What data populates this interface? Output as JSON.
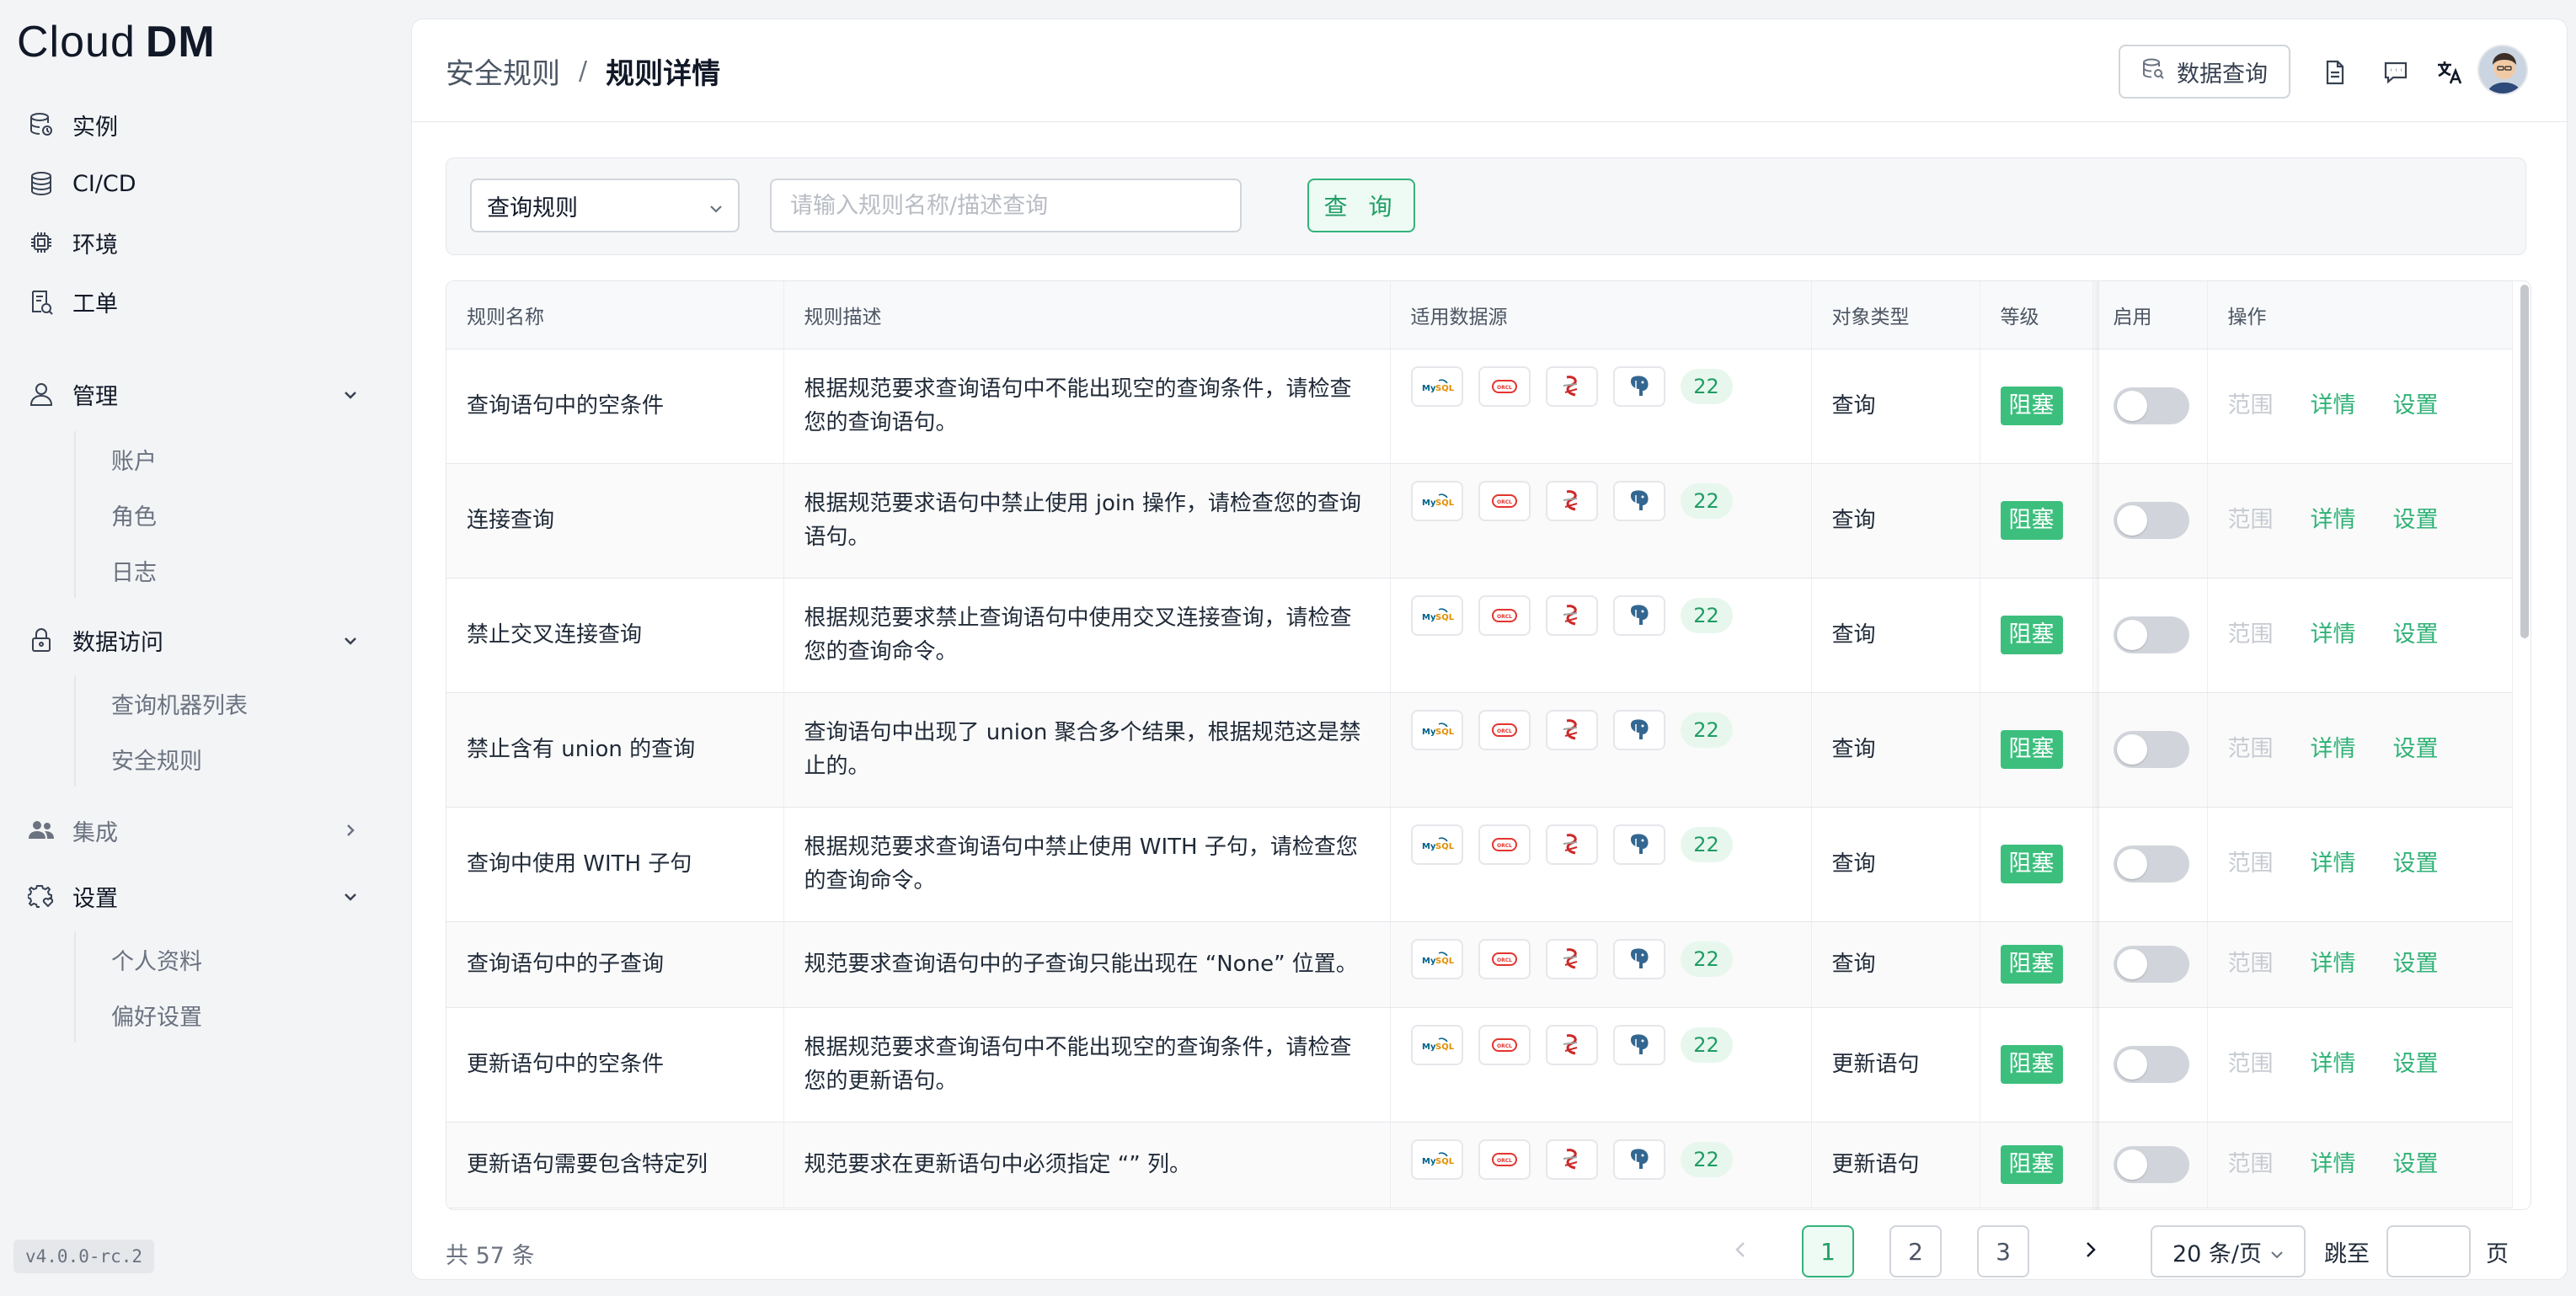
{
  "app": {
    "logo_text": "Cloud",
    "logo_text_bold": "DM",
    "version": "v4.0.0-rc.2"
  },
  "sidebar": {
    "items": [
      {
        "label": "实例",
        "icon": "database-stack-icon"
      },
      {
        "label": "CI/CD",
        "icon": "database-icon"
      },
      {
        "label": "环境",
        "icon": "chip-icon"
      },
      {
        "label": "工单",
        "icon": "ticket-icon"
      }
    ],
    "groups": [
      {
        "label": "管理",
        "icon": "user-icon",
        "expanded": true,
        "children": [
          "账户",
          "角色",
          "日志"
        ]
      },
      {
        "label": "数据访问",
        "icon": "lock-icon",
        "expanded": true,
        "children": [
          "查询机器列表",
          "安全规则"
        ]
      },
      {
        "label": "集成",
        "icon": "users-icon",
        "expanded": false,
        "children": []
      },
      {
        "label": "设置",
        "icon": "gear-heart-icon",
        "expanded": true,
        "children": [
          "个人资料",
          "偏好设置"
        ]
      }
    ]
  },
  "header": {
    "breadcrumb": [
      "安全规则",
      "规则详情"
    ],
    "separator": "/",
    "data_query_label": "数据查询",
    "icons": [
      "document-icon",
      "chat-icon",
      "translate-icon"
    ]
  },
  "filter": {
    "select_value": "查询规则",
    "search_placeholder": "请输入规则名称/描述查询",
    "query_button": "查 询"
  },
  "table": {
    "columns": [
      "规则名称",
      "规则描述",
      "适用数据源",
      "对象类型",
      "等级",
      "启用",
      "操作"
    ],
    "datasource_icons": [
      "mysql-icon",
      "oracle-icon",
      "sqlserver-icon",
      "postgresql-icon"
    ],
    "ops": {
      "range": "范围",
      "detail": "详情",
      "settings": "设置"
    },
    "rows": [
      {
        "name": "查询语句中的空条件",
        "desc": "根据规范要求查询语句中不能出现空的查询条件，请检查您的查询语句。",
        "count": "22",
        "type": "查询",
        "level": "阻塞",
        "enabled": false
      },
      {
        "name": "连接查询",
        "desc": "根据规范要求语句中禁止使用 join 操作，请检查您的查询语句。",
        "count": "22",
        "type": "查询",
        "level": "阻塞",
        "enabled": false
      },
      {
        "name": "禁止交叉连接查询",
        "desc": "根据规范要求禁止查询语句中使用交叉连接查询，请检查您的查询命令。",
        "count": "22",
        "type": "查询",
        "level": "阻塞",
        "enabled": false
      },
      {
        "name": "禁止含有 union 的查询",
        "desc": "查询语句中出现了 union 聚合多个结果，根据规范这是禁止的。",
        "count": "22",
        "type": "查询",
        "level": "阻塞",
        "enabled": false
      },
      {
        "name": "查询中使用 WITH 子句",
        "desc": "根据规范要求查询语句中禁止使用 WITH 子句，请检查您的查询命令。",
        "count": "22",
        "type": "查询",
        "level": "阻塞",
        "enabled": false
      },
      {
        "name": "查询语句中的子查询",
        "desc": "规范要求查询语句中的子查询只能出现在 “None” 位置。",
        "count": "22",
        "type": "查询",
        "level": "阻塞",
        "enabled": false
      },
      {
        "name": "更新语句中的空条件",
        "desc": "根据规范要求查询语句中不能出现空的查询条件，请检查您的更新语句。",
        "count": "22",
        "type": "更新语句",
        "level": "阻塞",
        "enabled": false
      },
      {
        "name": "更新语句需要包含特定列",
        "desc": "规范要求在更新语句中必须指定 “” 列。",
        "count": "22",
        "type": "更新语句",
        "level": "阻塞",
        "enabled": false
      }
    ]
  },
  "pagination": {
    "total_text": "共 57 条",
    "pages": [
      "1",
      "2",
      "3"
    ],
    "current": "1",
    "page_size": "20 条/页",
    "jump_label": "跳至",
    "jump_suffix": "页"
  },
  "colors": {
    "accent": "#34b27a",
    "level_block": "#3cbf7d",
    "count_badge_bg": "#e7f7ee"
  }
}
